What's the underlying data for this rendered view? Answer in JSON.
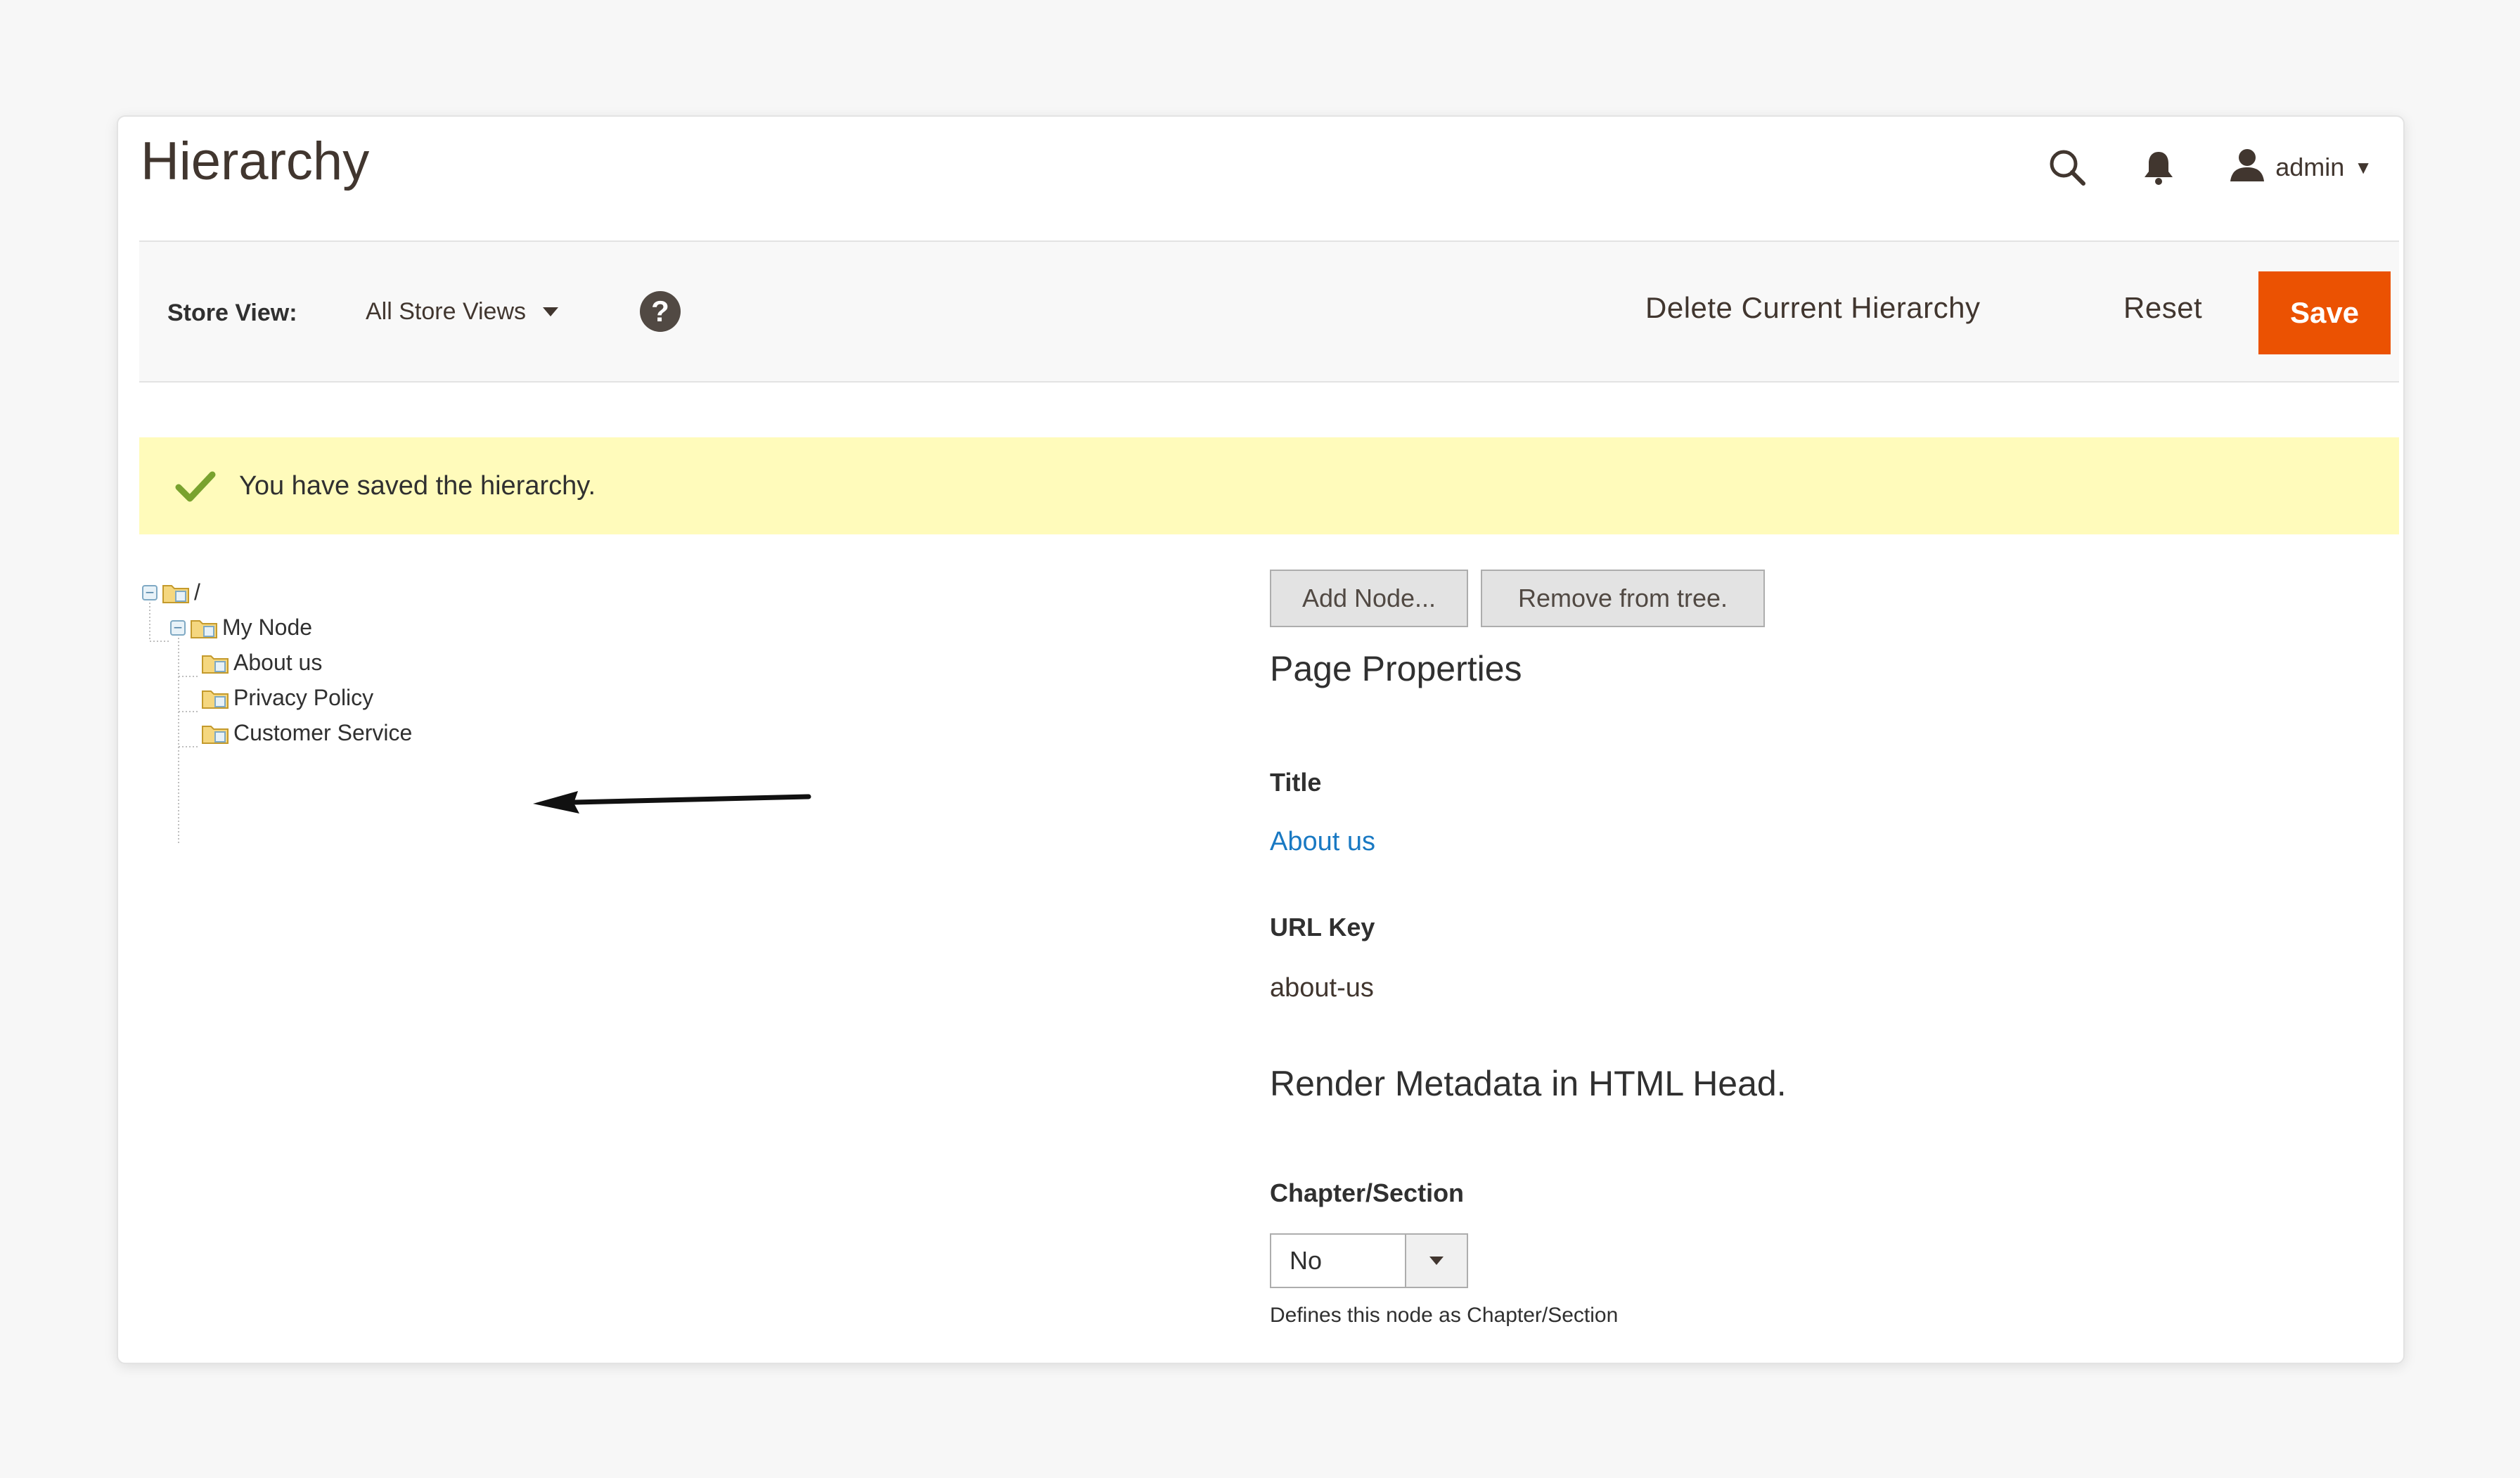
{
  "header": {
    "title": "Hierarchy",
    "user": "admin"
  },
  "toolbar": {
    "store_view_label": "Store View:",
    "store_view_value": "All Store Views",
    "help_symbol": "?",
    "delete_label": "Delete Current Hierarchy",
    "reset_label": "Reset",
    "save_label": "Save"
  },
  "message": {
    "text": "You have saved the hierarchy."
  },
  "tree": {
    "root": "/",
    "node": "My Node",
    "children": [
      "About us",
      "Privacy Policy",
      "Customer Service"
    ]
  },
  "form": {
    "add_node_label": "Add Node...",
    "remove_label": "Remove from tree.",
    "page_properties_title": "Page Properties",
    "title_label": "Title",
    "title_value": "About us",
    "url_key_label": "URL Key",
    "url_key_value": "about-us",
    "render_metadata_title": "Render Metadata in HTML Head.",
    "chapter_label": "Chapter/Section",
    "chapter_value": "No",
    "chapter_note": "Defines this node as Chapter/Section"
  },
  "icons": {
    "search": "search-icon",
    "bell": "bell-icon",
    "user": "user-icon",
    "check": "check-icon",
    "folder": "folder-icon",
    "arrow": "arrow-left-icon"
  },
  "colors": {
    "accent": "#eb5202",
    "message_bg": "#fffbbb",
    "link": "#1979c3",
    "success": "#79a22e"
  }
}
